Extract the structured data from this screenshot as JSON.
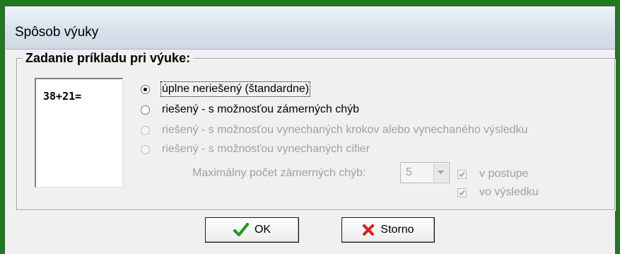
{
  "window": {
    "title": "Spôsob výuky"
  },
  "group": {
    "legend": "Zadanie príkladu pri výuke:"
  },
  "preview": {
    "text": "38+21="
  },
  "options": [
    {
      "label": "úplne neriešený (štandardne)",
      "checked": true,
      "enabled": true
    },
    {
      "label": "riešený - s možnosťou zámerných chýb",
      "checked": false,
      "enabled": true
    },
    {
      "label": "riešený - s možnosťou vynechaných krokov alebo vynechaného výsledku",
      "checked": false,
      "enabled": false
    },
    {
      "label": "riešený - s možnosťou vynechaných cifier",
      "checked": false,
      "enabled": false
    }
  ],
  "max_errors": {
    "label": "Maximálny počet zámerných chýb:",
    "value": "5"
  },
  "checks": [
    {
      "label": "v postupe",
      "checked": true,
      "enabled": false
    },
    {
      "label": "vo výsledku",
      "checked": true,
      "enabled": false
    }
  ],
  "buttons": {
    "ok": "OK",
    "cancel": "Storno"
  },
  "colors": {
    "ok_icon": "#1a9a1a",
    "cancel_icon": "#d81e1e",
    "frame": "#1f7a1f"
  },
  "icons": {
    "ok": "checkmark-icon",
    "cancel": "x-icon"
  }
}
